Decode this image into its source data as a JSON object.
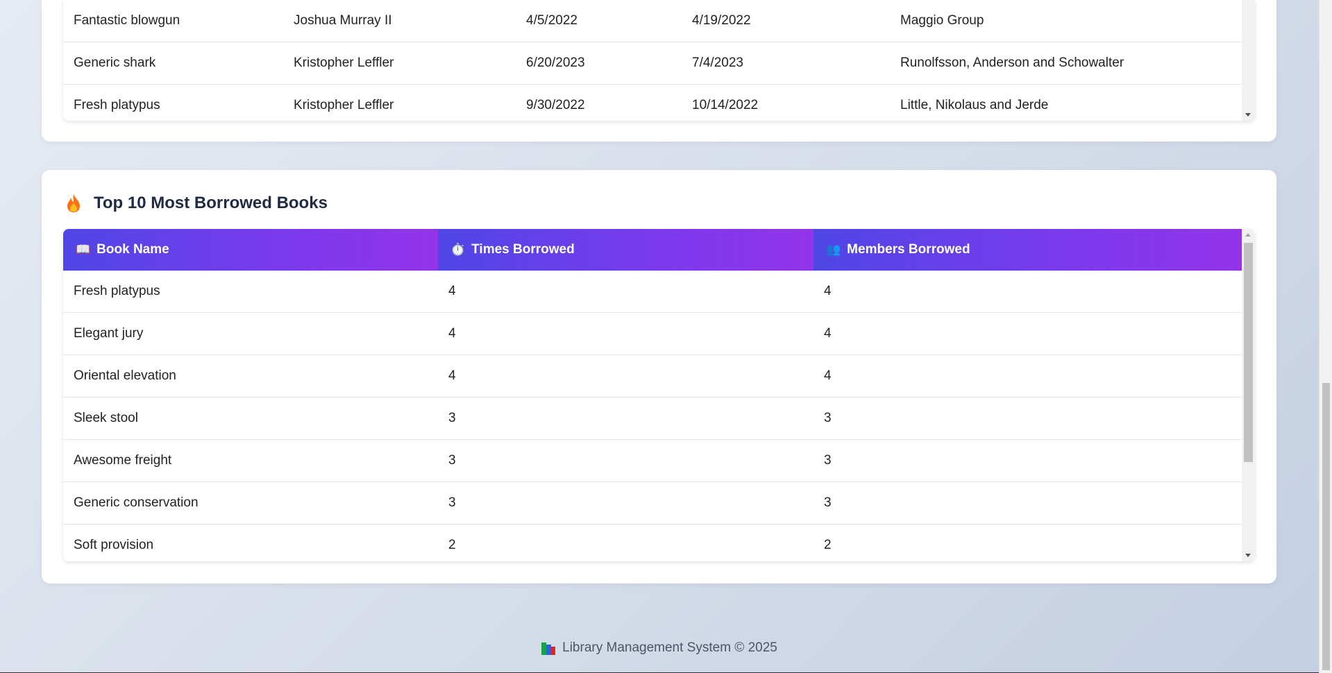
{
  "loans_table": {
    "rows": [
      [
        "Fantastic blowgun",
        "Joshua Murray II",
        "4/5/2022",
        "4/19/2022",
        "Maggio Group"
      ],
      [
        "Generic shark",
        "Kristopher Leffler",
        "6/20/2023",
        "7/4/2023",
        "Runolfsson, Anderson and Schowalter"
      ],
      [
        "Fresh platypus",
        "Kristopher Leffler",
        "9/30/2022",
        "10/14/2022",
        "Little, Nikolaus and Jerde"
      ]
    ]
  },
  "top_books": {
    "title": "Top 10 Most Borrowed Books",
    "title_icon": "flame-icon",
    "headers": [
      {
        "icon": "📖",
        "label": "Book Name"
      },
      {
        "icon": "⏱️",
        "label": "Times Borrowed"
      },
      {
        "icon": "👥",
        "label": "Members Borrowed"
      }
    ],
    "rows": [
      [
        "Fresh platypus",
        "4",
        "4"
      ],
      [
        "Elegant jury",
        "4",
        "4"
      ],
      [
        "Oriental elevation",
        "4",
        "4"
      ],
      [
        "Sleek stool",
        "3",
        "3"
      ],
      [
        "Awesome freight",
        "3",
        "3"
      ],
      [
        "Generic conservation",
        "3",
        "3"
      ],
      [
        "Soft provision",
        "2",
        "2"
      ]
    ]
  },
  "footer": {
    "text": "Library Management System © 2025",
    "icon": "books-icon"
  },
  "colors": {
    "header_gradient_start": "#4f46e5",
    "header_gradient_end": "#9333ea",
    "title_color": "#1f2a44"
  }
}
